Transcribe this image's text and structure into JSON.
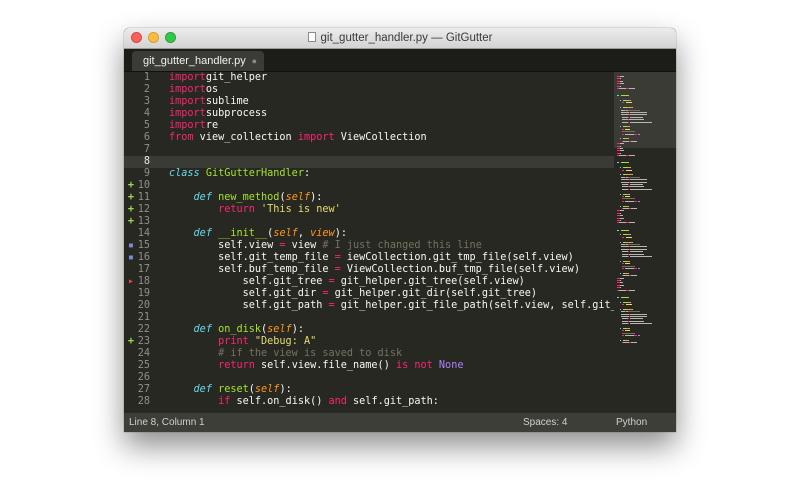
{
  "window": {
    "title": "git_gutter_handler.py — GitGutter"
  },
  "tab": {
    "label": "git_gutter_handler.py"
  },
  "status": {
    "position": "Line 8, Column 1",
    "indentation": "Spaces: 4",
    "syntax": "Python"
  },
  "colors": {
    "editor_bg": "#272822",
    "keyword": "#f92672",
    "string": "#e6db74",
    "function": "#a6e22e",
    "storage": "#66d9ef",
    "parameter": "#fd971f",
    "comment": "#75715e",
    "constant": "#ae81ff",
    "gutter_added": "#9bdb4d",
    "gutter_modified": "#7a8ad8",
    "gutter_deleted": "#e04a4a"
  },
  "editor": {
    "current_line": 8,
    "lines": [
      {
        "n": "1",
        "marker": "",
        "tokens": [
          [
            "k",
            "import"
          ],
          [
            "",
            "git_helper"
          ]
        ]
      },
      {
        "n": "2",
        "marker": "",
        "tokens": [
          [
            "k",
            "import"
          ],
          [
            "",
            "os"
          ]
        ]
      },
      {
        "n": "3",
        "marker": "",
        "tokens": [
          [
            "k",
            "import"
          ],
          [
            "",
            "sublime"
          ]
        ]
      },
      {
        "n": "4",
        "marker": "",
        "tokens": [
          [
            "k",
            "import"
          ],
          [
            "",
            "subprocess"
          ]
        ]
      },
      {
        "n": "5",
        "marker": "",
        "tokens": [
          [
            "k",
            "import"
          ],
          [
            "",
            "re"
          ]
        ]
      },
      {
        "n": "6",
        "marker": "",
        "tokens": [
          [
            "k",
            "from"
          ],
          [
            "",
            " view_collection "
          ],
          [
            "k",
            "import"
          ],
          [
            "",
            " ViewCollection"
          ]
        ]
      },
      {
        "n": "7",
        "marker": "",
        "tokens": []
      },
      {
        "n": "8",
        "marker": "",
        "tokens": []
      },
      {
        "n": "9",
        "marker": "",
        "tokens": [
          [
            "st",
            "class"
          ],
          [
            "",
            " "
          ],
          [
            "f",
            "GitGutterHandler"
          ],
          [
            "",
            ":"
          ]
        ]
      },
      {
        "n": "10",
        "marker": "added",
        "tokens": []
      },
      {
        "n": "11",
        "marker": "added",
        "tokens": [
          [
            "",
            "    "
          ],
          [
            "st",
            "def"
          ],
          [
            "",
            " "
          ],
          [
            "f",
            "new_method"
          ],
          [
            "",
            "("
          ],
          [
            "p",
            "self"
          ],
          [
            "",
            "):"
          ]
        ]
      },
      {
        "n": "12",
        "marker": "added",
        "tokens": [
          [
            "",
            "        "
          ],
          [
            "k",
            "return"
          ],
          [
            "",
            " "
          ],
          [
            "s",
            "'This is new'"
          ]
        ]
      },
      {
        "n": "13",
        "marker": "added",
        "tokens": []
      },
      {
        "n": "14",
        "marker": "",
        "tokens": [
          [
            "",
            "    "
          ],
          [
            "st",
            "def"
          ],
          [
            "",
            " "
          ],
          [
            "f",
            "__init__"
          ],
          [
            "",
            "("
          ],
          [
            "p",
            "self"
          ],
          [
            "",
            ", "
          ],
          [
            "p",
            "view"
          ],
          [
            "",
            "):"
          ]
        ]
      },
      {
        "n": "15",
        "marker": "modified",
        "tokens": [
          [
            "",
            "        self.view "
          ],
          [
            "k",
            "="
          ],
          [
            "",
            " view "
          ],
          [
            "c",
            "# I just changed this line"
          ]
        ]
      },
      {
        "n": "16",
        "marker": "modified",
        "tokens": [
          [
            "",
            "        self.git_temp_file "
          ],
          [
            "k",
            "="
          ],
          [
            "",
            " iewCollection.git_tmp_file(self.view)"
          ]
        ]
      },
      {
        "n": "17",
        "marker": "",
        "tokens": [
          [
            "",
            "        self.buf_temp_file "
          ],
          [
            "k",
            "="
          ],
          [
            "",
            " ViewCollection.buf_tmp_file(self.view)"
          ]
        ]
      },
      {
        "n": "18",
        "marker": "deleted",
        "tokens": [
          [
            "",
            "            self.git_tree "
          ],
          [
            "k",
            "="
          ],
          [
            "",
            " git_helper.git_tree(self.view)"
          ]
        ]
      },
      {
        "n": "19",
        "marker": "",
        "tokens": [
          [
            "",
            "            self.git_dir "
          ],
          [
            "k",
            "="
          ],
          [
            "",
            " git_helper.git_dir(self.git_tree)"
          ]
        ]
      },
      {
        "n": "20",
        "marker": "",
        "tokens": [
          [
            "",
            "            self.git_path "
          ],
          [
            "k",
            "="
          ],
          [
            "",
            " git_helper.git_file_path(self.view, self.git_tree)"
          ]
        ]
      },
      {
        "n": "21",
        "marker": "",
        "tokens": []
      },
      {
        "n": "22",
        "marker": "",
        "tokens": [
          [
            "",
            "    "
          ],
          [
            "st",
            "def"
          ],
          [
            "",
            " "
          ],
          [
            "f",
            "on_disk"
          ],
          [
            "",
            "("
          ],
          [
            "p",
            "self"
          ],
          [
            "",
            "):"
          ]
        ]
      },
      {
        "n": "23",
        "marker": "added",
        "tokens": [
          [
            "",
            "        "
          ],
          [
            "k",
            "print"
          ],
          [
            "",
            " "
          ],
          [
            "s",
            "\"Debug: A\""
          ]
        ]
      },
      {
        "n": "24",
        "marker": "",
        "tokens": [
          [
            "",
            "        "
          ],
          [
            "c",
            "# if the view is saved to disk"
          ]
        ]
      },
      {
        "n": "25",
        "marker": "",
        "tokens": [
          [
            "",
            "        "
          ],
          [
            "k",
            "return"
          ],
          [
            "",
            " self.view.file_name() "
          ],
          [
            "k",
            "is not"
          ],
          [
            "",
            " "
          ],
          [
            "n",
            "None"
          ]
        ]
      },
      {
        "n": "26",
        "marker": "",
        "tokens": []
      },
      {
        "n": "27",
        "marker": "",
        "tokens": [
          [
            "",
            "    "
          ],
          [
            "st",
            "def"
          ],
          [
            "",
            " "
          ],
          [
            "f",
            "reset"
          ],
          [
            "",
            "("
          ],
          [
            "p",
            "self"
          ],
          [
            "",
            "):"
          ]
        ]
      },
      {
        "n": "28",
        "marker": "",
        "tokens": [
          [
            "",
            "        "
          ],
          [
            "k",
            "if"
          ],
          [
            "",
            " self.on_disk() "
          ],
          [
            "k",
            "and"
          ],
          [
            "",
            " self.git_path:"
          ]
        ]
      }
    ]
  }
}
